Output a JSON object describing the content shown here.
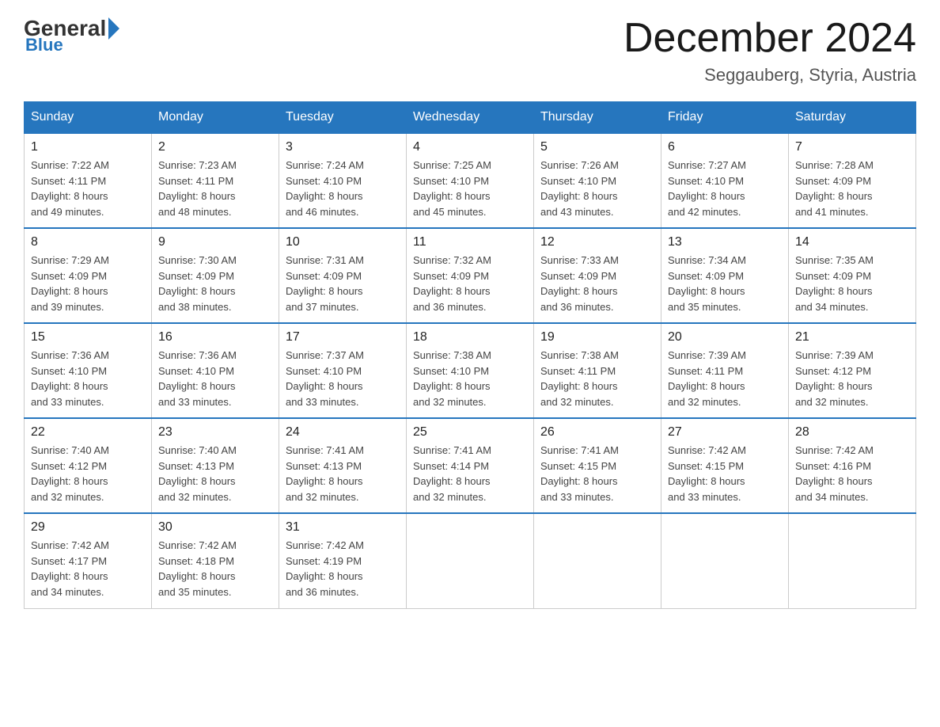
{
  "header": {
    "logo_general": "General",
    "logo_blue": "Blue",
    "month_title": "December 2024",
    "location": "Seggauberg, Styria, Austria"
  },
  "days_of_week": [
    "Sunday",
    "Monday",
    "Tuesday",
    "Wednesday",
    "Thursday",
    "Friday",
    "Saturday"
  ],
  "weeks": [
    [
      {
        "day": "1",
        "sunrise": "7:22 AM",
        "sunset": "4:11 PM",
        "daylight": "8 hours and 49 minutes."
      },
      {
        "day": "2",
        "sunrise": "7:23 AM",
        "sunset": "4:11 PM",
        "daylight": "8 hours and 48 minutes."
      },
      {
        "day": "3",
        "sunrise": "7:24 AM",
        "sunset": "4:10 PM",
        "daylight": "8 hours and 46 minutes."
      },
      {
        "day": "4",
        "sunrise": "7:25 AM",
        "sunset": "4:10 PM",
        "daylight": "8 hours and 45 minutes."
      },
      {
        "day": "5",
        "sunrise": "7:26 AM",
        "sunset": "4:10 PM",
        "daylight": "8 hours and 43 minutes."
      },
      {
        "day": "6",
        "sunrise": "7:27 AM",
        "sunset": "4:10 PM",
        "daylight": "8 hours and 42 minutes."
      },
      {
        "day": "7",
        "sunrise": "7:28 AM",
        "sunset": "4:09 PM",
        "daylight": "8 hours and 41 minutes."
      }
    ],
    [
      {
        "day": "8",
        "sunrise": "7:29 AM",
        "sunset": "4:09 PM",
        "daylight": "8 hours and 39 minutes."
      },
      {
        "day": "9",
        "sunrise": "7:30 AM",
        "sunset": "4:09 PM",
        "daylight": "8 hours and 38 minutes."
      },
      {
        "day": "10",
        "sunrise": "7:31 AM",
        "sunset": "4:09 PM",
        "daylight": "8 hours and 37 minutes."
      },
      {
        "day": "11",
        "sunrise": "7:32 AM",
        "sunset": "4:09 PM",
        "daylight": "8 hours and 36 minutes."
      },
      {
        "day": "12",
        "sunrise": "7:33 AM",
        "sunset": "4:09 PM",
        "daylight": "8 hours and 36 minutes."
      },
      {
        "day": "13",
        "sunrise": "7:34 AM",
        "sunset": "4:09 PM",
        "daylight": "8 hours and 35 minutes."
      },
      {
        "day": "14",
        "sunrise": "7:35 AM",
        "sunset": "4:09 PM",
        "daylight": "8 hours and 34 minutes."
      }
    ],
    [
      {
        "day": "15",
        "sunrise": "7:36 AM",
        "sunset": "4:10 PM",
        "daylight": "8 hours and 33 minutes."
      },
      {
        "day": "16",
        "sunrise": "7:36 AM",
        "sunset": "4:10 PM",
        "daylight": "8 hours and 33 minutes."
      },
      {
        "day": "17",
        "sunrise": "7:37 AM",
        "sunset": "4:10 PM",
        "daylight": "8 hours and 33 minutes."
      },
      {
        "day": "18",
        "sunrise": "7:38 AM",
        "sunset": "4:10 PM",
        "daylight": "8 hours and 32 minutes."
      },
      {
        "day": "19",
        "sunrise": "7:38 AM",
        "sunset": "4:11 PM",
        "daylight": "8 hours and 32 minutes."
      },
      {
        "day": "20",
        "sunrise": "7:39 AM",
        "sunset": "4:11 PM",
        "daylight": "8 hours and 32 minutes."
      },
      {
        "day": "21",
        "sunrise": "7:39 AM",
        "sunset": "4:12 PM",
        "daylight": "8 hours and 32 minutes."
      }
    ],
    [
      {
        "day": "22",
        "sunrise": "7:40 AM",
        "sunset": "4:12 PM",
        "daylight": "8 hours and 32 minutes."
      },
      {
        "day": "23",
        "sunrise": "7:40 AM",
        "sunset": "4:13 PM",
        "daylight": "8 hours and 32 minutes."
      },
      {
        "day": "24",
        "sunrise": "7:41 AM",
        "sunset": "4:13 PM",
        "daylight": "8 hours and 32 minutes."
      },
      {
        "day": "25",
        "sunrise": "7:41 AM",
        "sunset": "4:14 PM",
        "daylight": "8 hours and 32 minutes."
      },
      {
        "day": "26",
        "sunrise": "7:41 AM",
        "sunset": "4:15 PM",
        "daylight": "8 hours and 33 minutes."
      },
      {
        "day": "27",
        "sunrise": "7:42 AM",
        "sunset": "4:15 PM",
        "daylight": "8 hours and 33 minutes."
      },
      {
        "day": "28",
        "sunrise": "7:42 AM",
        "sunset": "4:16 PM",
        "daylight": "8 hours and 34 minutes."
      }
    ],
    [
      {
        "day": "29",
        "sunrise": "7:42 AM",
        "sunset": "4:17 PM",
        "daylight": "8 hours and 34 minutes."
      },
      {
        "day": "30",
        "sunrise": "7:42 AM",
        "sunset": "4:18 PM",
        "daylight": "8 hours and 35 minutes."
      },
      {
        "day": "31",
        "sunrise": "7:42 AM",
        "sunset": "4:19 PM",
        "daylight": "8 hours and 36 minutes."
      },
      null,
      null,
      null,
      null
    ]
  ],
  "labels": {
    "sunrise_prefix": "Sunrise: ",
    "sunset_prefix": "Sunset: ",
    "daylight_prefix": "Daylight: "
  }
}
